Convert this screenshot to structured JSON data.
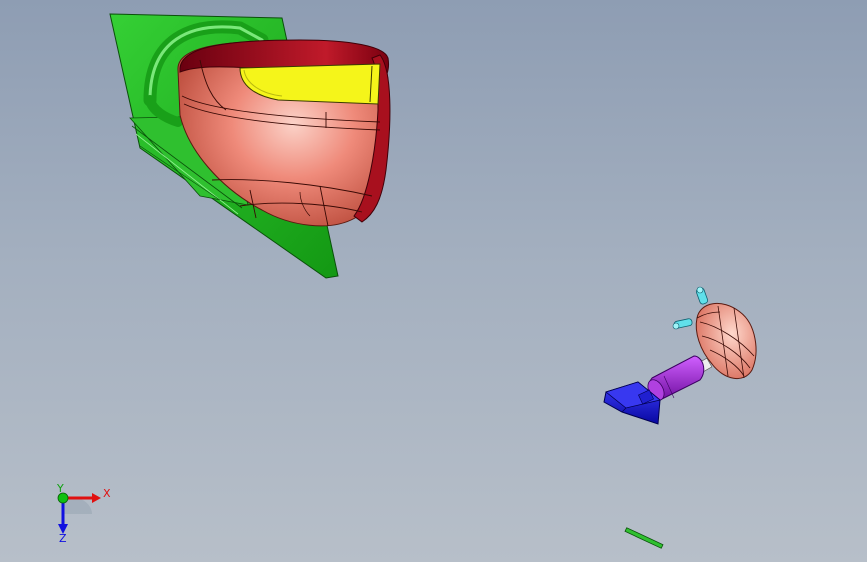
{
  "viewport": {
    "background_top": "#8e9db3",
    "background_bottom": "#b7bfc9"
  },
  "parts": [
    {
      "name": "mirror-housing",
      "color": "#e98070",
      "trim_color": "#9b0f1e",
      "lamp_color": "#f5f51a"
    },
    {
      "name": "mounting-plate",
      "color": "#22b022"
    },
    {
      "name": "mirror-glass-assembly",
      "color": "#e98070"
    },
    {
      "name": "support-arm",
      "color": "#a020d0"
    },
    {
      "name": "base-bracket",
      "color": "#1a1ad8"
    },
    {
      "name": "clip-left",
      "color": "#50d8e0"
    },
    {
      "name": "clip-top",
      "color": "#50d8e0"
    },
    {
      "name": "small-pin",
      "color": "#22b022"
    }
  ],
  "triad": {
    "x_label": "X",
    "y_label": "Y",
    "z_label": "Z",
    "x_color": "#e01010",
    "y_color": "#10c010",
    "z_color": "#1010e0"
  }
}
